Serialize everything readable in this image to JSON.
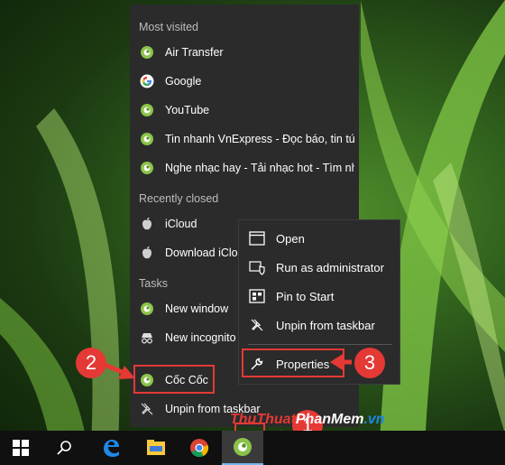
{
  "jump_list": {
    "most_visited_header": "Most visited",
    "most_visited": [
      {
        "label": "Air Transfer",
        "icon": "coccoc-icon"
      },
      {
        "label": "Google",
        "icon": "google-icon"
      },
      {
        "label": "YouTube",
        "icon": "coccoc-icon"
      },
      {
        "label": "Tin nhanh VnExpress - Đọc báo, tin tức…",
        "icon": "coccoc-icon"
      },
      {
        "label": "Nghe nhạc hay - Tải nhạc hot - Tìm nh…",
        "icon": "coccoc-icon"
      }
    ],
    "recently_closed_header": "Recently closed",
    "recently_closed": [
      {
        "label": "iCloud",
        "icon": "apple-icon"
      },
      {
        "label": "Download iCloud",
        "icon": "apple-icon"
      }
    ],
    "tasks_header": "Tasks",
    "tasks": [
      {
        "label": "New window",
        "icon": "coccoc-icon"
      },
      {
        "label": "New incognito",
        "icon": "incognito-icon"
      }
    ],
    "pinned_app": "Cốc Cốc",
    "unpin": "Unpin from taskbar"
  },
  "context_menu": {
    "items": [
      {
        "label": "Open",
        "icon": "window-icon"
      },
      {
        "label": "Run as administrator",
        "icon": "shield-icon"
      },
      {
        "label": "Pin to Start",
        "icon": "pin-start-icon"
      },
      {
        "label": "Unpin from taskbar",
        "icon": "unpin-icon"
      },
      {
        "label": "Properties",
        "icon": "wrench-icon"
      }
    ]
  },
  "annotations": {
    "step1": "1",
    "step2": "2",
    "step3": "3"
  },
  "watermark": {
    "part1": "ThuThuat",
    "part2": "PhanMem",
    "part3": ".vn"
  },
  "colors": {
    "highlight": "#e53935",
    "menu_bg": "#2b2b2b",
    "taskbar": "#101010"
  }
}
